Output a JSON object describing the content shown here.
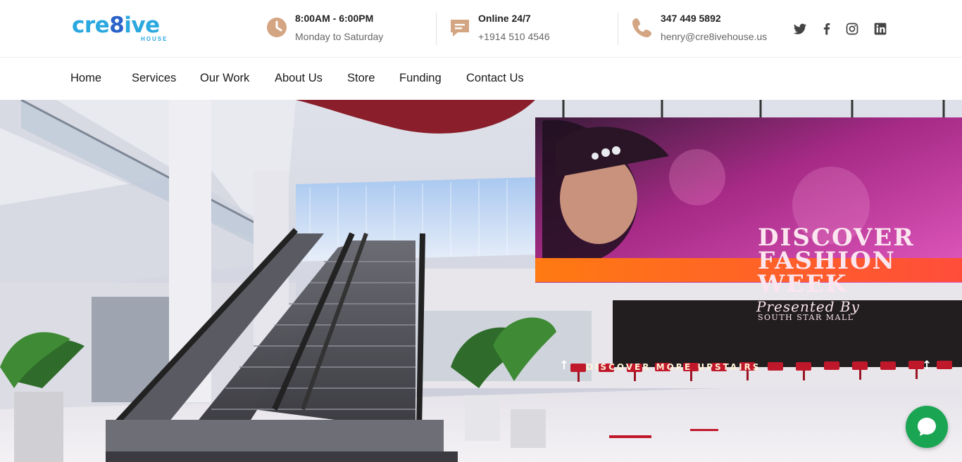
{
  "brand": {
    "logo_text_a": "cre",
    "logo_text_b": "8",
    "logo_text_c": "ive",
    "logo_sub": "HOUSE",
    "primary_color": "#2aa8e0",
    "accent_color": "#d4a582"
  },
  "header": {
    "hours": {
      "icon": "clock-icon",
      "line1": "8:00AM - 6:00PM",
      "line2": "Monday to Saturday"
    },
    "online": {
      "icon": "chat-icon",
      "line1": "Online 24/7",
      "line2": "+1914 510 4546"
    },
    "contact": {
      "icon": "phone-icon",
      "line1": "347 449 5892",
      "line2": "henry@cre8ivehouse.us"
    },
    "social": [
      "twitter-icon",
      "facebook-icon",
      "instagram-icon",
      "linkedin-icon"
    ]
  },
  "nav": {
    "items": [
      "Home",
      "Services",
      "Our Work",
      "About Us",
      "Store",
      "Funding",
      "Contact Us"
    ]
  },
  "hero": {
    "billboard": {
      "title_line1": "DISCOVER",
      "title_line2": "FASHION",
      "title_line3": "WEEK",
      "subtitle": "Presented By",
      "mall": "SOUTH STAR MALL",
      "strip": "DISCOVER MORE UPSTAIRS"
    }
  },
  "chat_widget": {
    "icon": "chat-bubble-icon",
    "color": "#1aa553"
  }
}
